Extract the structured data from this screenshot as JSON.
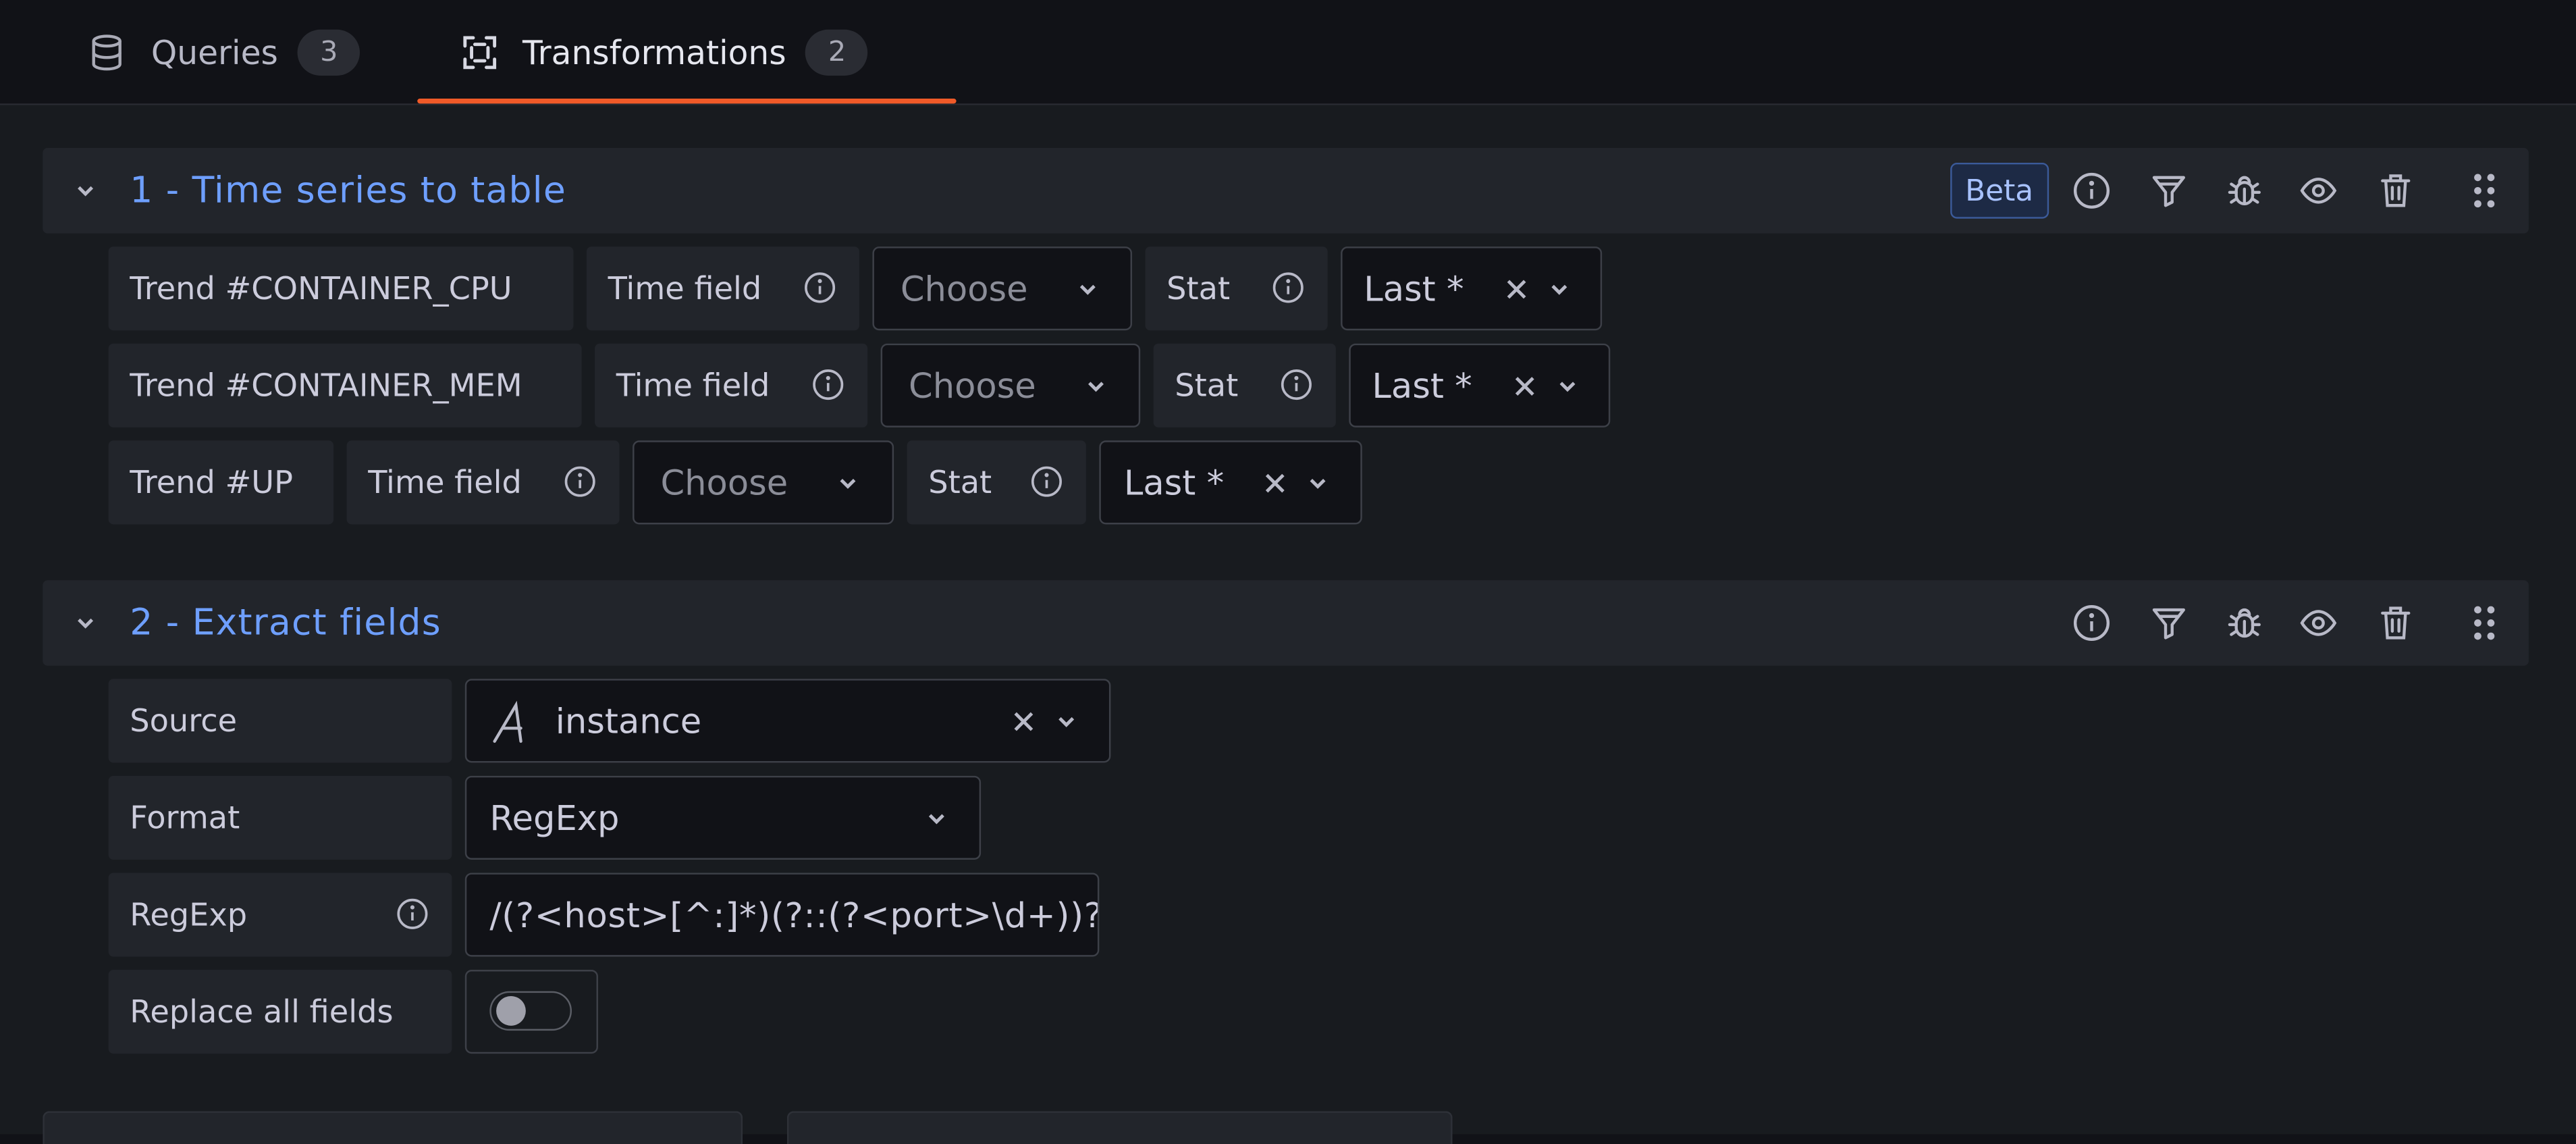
{
  "tabs": [
    {
      "label": "Queries",
      "count": "3",
      "icon": "database-icon"
    },
    {
      "label": "Transformations",
      "count": "2",
      "icon": "transform-icon"
    }
  ],
  "transformations": [
    {
      "title": "1 - Time series to table",
      "badge": "Beta",
      "rows": [
        {
          "trend": "Trend #CONTAINER_CPU",
          "time_field_label": "Time field",
          "time_field_value": "Choose",
          "stat_label": "Stat",
          "stat_value": "Last *"
        },
        {
          "trend": "Trend #CONTAINER_MEM",
          "time_field_label": "Time field",
          "time_field_value": "Choose",
          "stat_label": "Stat",
          "stat_value": "Last *"
        },
        {
          "trend": "Trend #UP",
          "time_field_label": "Time field",
          "time_field_value": "Choose",
          "stat_label": "Stat",
          "stat_value": "Last *"
        }
      ]
    },
    {
      "title": "2 - Extract fields",
      "source_label": "Source",
      "source_value": "instance",
      "format_label": "Format",
      "format_value": "RegExp",
      "regexp_label": "RegExp",
      "regexp_value": "/(?<host>[^:]*)(?::(?<port>\\d+))?/",
      "replace_label": "Replace all fields",
      "replace_all_fields": false
    }
  ],
  "header_icons": [
    "info-icon",
    "filter-icon",
    "debug-icon",
    "eye-icon",
    "trash-icon",
    "drag-handle-icon"
  ],
  "colors": {
    "accent": "#f05a28",
    "title": "#6e9fff",
    "background": "#181b1f",
    "panel": "#22252b"
  }
}
